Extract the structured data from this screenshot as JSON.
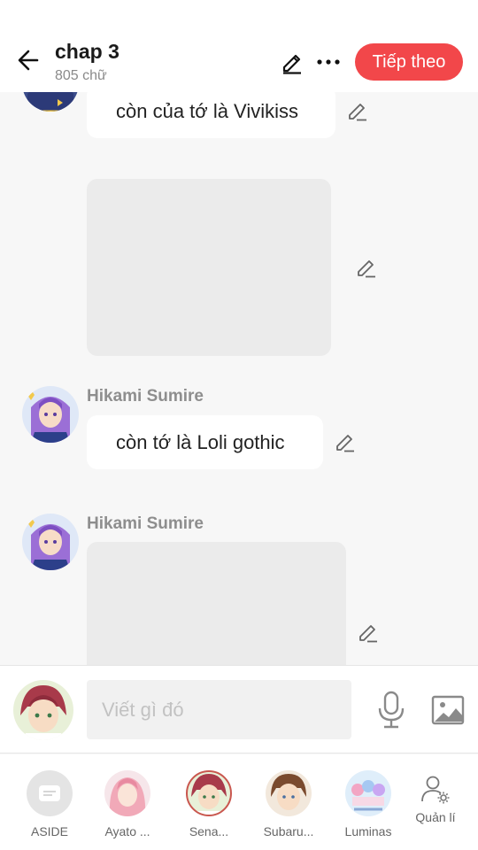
{
  "header": {
    "title": "chap 3",
    "word_count": "805 chữ",
    "next_button": "Tiếp theo",
    "accent_color": "#f2474a"
  },
  "messages": [
    {
      "type": "text",
      "sender": "",
      "text": "còn của tớ là Vivikiss"
    },
    {
      "type": "image",
      "sender": ""
    },
    {
      "type": "text",
      "sender": "Hikami Sumire",
      "text": "còn tớ là Loli gothic"
    },
    {
      "type": "image",
      "sender": "Hikami Sumire"
    }
  ],
  "composer": {
    "placeholder": "Viết gì đó",
    "icons": [
      "mic-icon",
      "image-icon"
    ]
  },
  "characters": [
    {
      "label": "ASIDE",
      "icon": "aside-icon"
    },
    {
      "label": "Ayato ..."
    },
    {
      "label": "Sena..."
    },
    {
      "label": "Subaru..."
    },
    {
      "label": "Luminas"
    },
    {
      "label": "Quản lí",
      "icon": "manage-user-icon"
    }
  ]
}
